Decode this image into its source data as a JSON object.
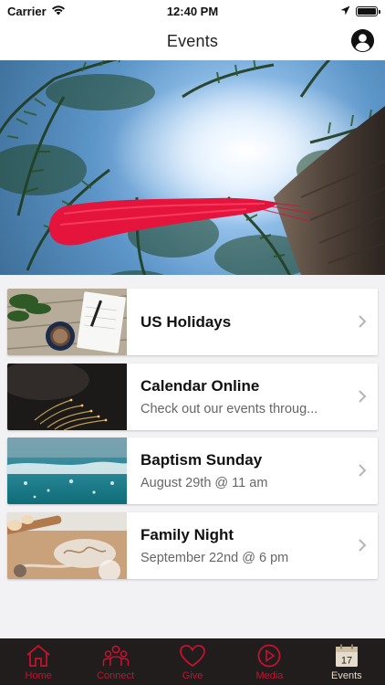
{
  "status_bar": {
    "carrier": "Carrier",
    "time": "12:40 PM"
  },
  "nav": {
    "title": "Events",
    "profile_icon": "person-circle-icon"
  },
  "events": [
    {
      "title": "US Holidays",
      "subtitle": "",
      "thumbnail": "desk-coffee-notebook"
    },
    {
      "title": "Calendar Online",
      "subtitle": "Check out our events throug...",
      "thumbnail": "dark-lights"
    },
    {
      "title": "Baptism Sunday",
      "subtitle": "August 29th @ 11 am",
      "thumbnail": "water-splash"
    },
    {
      "title": "Family Night",
      "subtitle": "September 22nd @ 6 pm",
      "thumbnail": "family-baking"
    }
  ],
  "tabs": [
    {
      "label": "Home",
      "icon": "home-icon",
      "active": false
    },
    {
      "label": "Connect",
      "icon": "people-icon",
      "active": false
    },
    {
      "label": "Give",
      "icon": "heart-icon",
      "active": false
    },
    {
      "label": "Media",
      "icon": "play-circle-icon",
      "active": false
    },
    {
      "label": "Events",
      "icon": "calendar-icon",
      "active": true,
      "badge": "17"
    }
  ],
  "colors": {
    "accent_red": "#c4122f",
    "tab_bar_bg": "#211d1d",
    "active_tab": "#e6dccb"
  }
}
